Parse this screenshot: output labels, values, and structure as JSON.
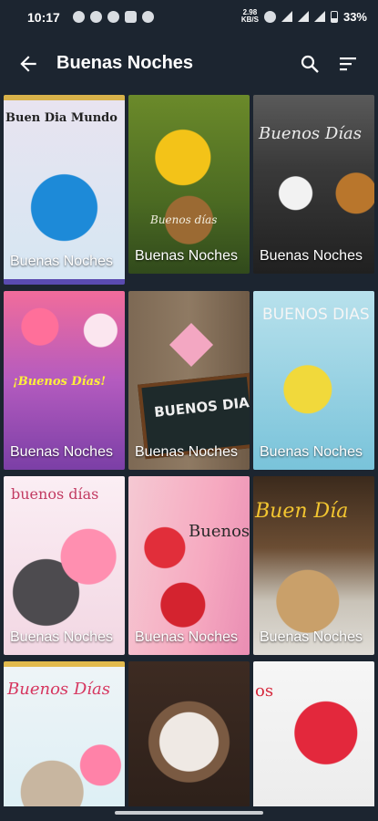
{
  "status_bar": {
    "time": "10:17",
    "net_speed_value": "2.98",
    "net_speed_unit": "KB/S",
    "battery": "33%"
  },
  "app_bar": {
    "title": "Buenas Noches",
    "back_icon": "arrow-back-icon",
    "search_icon": "search-icon",
    "sort_icon": "sort-icon"
  },
  "grid": {
    "items": [
      {
        "label": "Buenas Noches",
        "overlay": "Buen Dia Mundo"
      },
      {
        "label": "Buenas Noches",
        "overlay": "Buenos días"
      },
      {
        "label": "Buenas Noches",
        "overlay": "Buenos Días"
      },
      {
        "label": "Buenas Noches",
        "overlay": "¡Buenos Días!"
      },
      {
        "label": "Buenas Noches",
        "overlay": "BUENOS DIAS"
      },
      {
        "label": "Buenas Noches",
        "overlay": "BUENOS DIAS"
      },
      {
        "label": "Buenas Noches",
        "overlay": "buenos días"
      },
      {
        "label": "Buenas Noches",
        "overlay": "Buenos Días"
      },
      {
        "label": "Buenas Noches",
        "overlay": "Buen Día"
      },
      {
        "label": "",
        "overlay": "Buenos Días"
      },
      {
        "label": "",
        "overlay": ""
      },
      {
        "label": "",
        "overlay": "os"
      }
    ]
  }
}
